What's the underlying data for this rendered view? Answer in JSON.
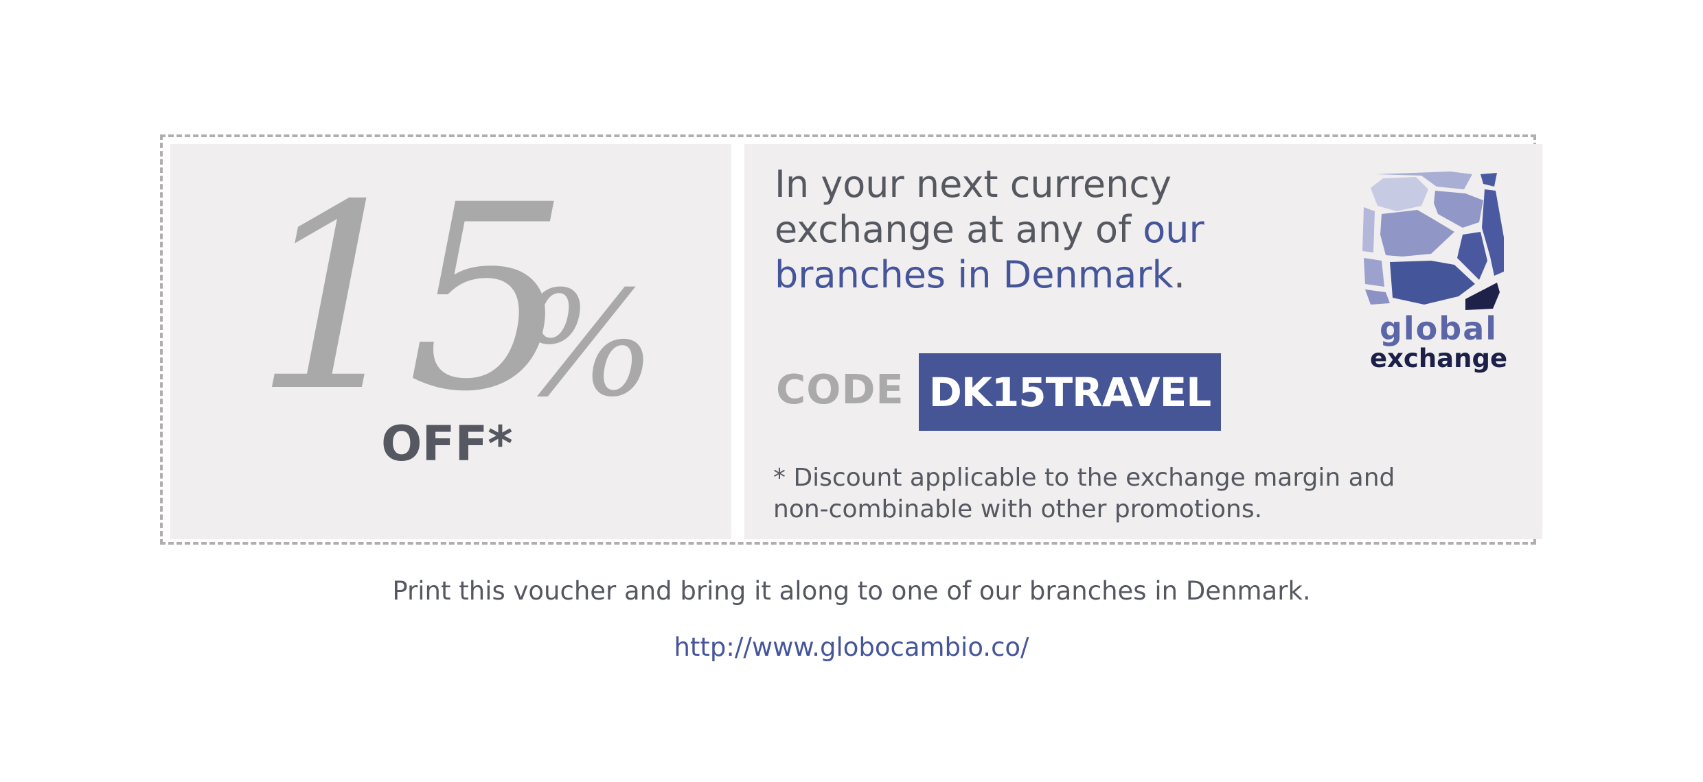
{
  "voucher": {
    "discount": {
      "number": "15",
      "percent_sign": "%",
      "off_label": "OFF*"
    },
    "headline": {
      "text_plain": "In your next currency exchange at any of ",
      "text_highlight": "our branches in Denmark",
      "text_end": "."
    },
    "code": {
      "label": "CODE",
      "value": "DK15TRAVEL"
    },
    "disclaimer": "* Discount applicable to the exchange margin and non-combinable with other promotions.",
    "logo": {
      "word1": "global",
      "word2": "exchange"
    }
  },
  "footer": {
    "note": "Print this voucher and bring it along to one of our branches in Denmark.",
    "link": "http://www.globocambio.co/"
  },
  "colors": {
    "accent": "#45559a",
    "text": "#555860",
    "muted": "#a9a9a9",
    "panel": "#f0eeef"
  }
}
